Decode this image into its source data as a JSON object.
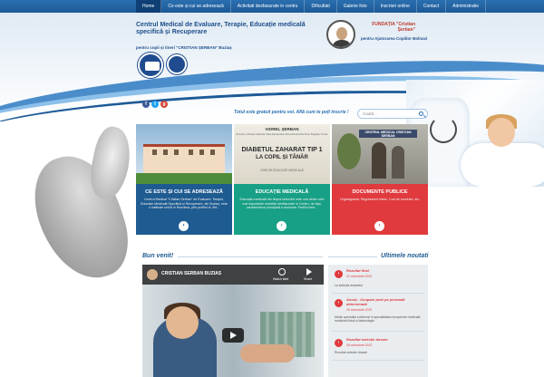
{
  "nav": {
    "items": [
      "Home",
      "Ce este și cui se adresează",
      "Activitati desfasurate in centru",
      "Dificultati",
      "Galerie foto",
      "Inscrieri online",
      "Contact",
      "Administratie"
    ],
    "active_index": 0
  },
  "header": {
    "org_title": "Centrul Medical de Evaluare, Terapie, Educație medicală specifică și Recuperare",
    "org_subtitle": "pentru copii și tineri \"CRISTIAN ȘERBAN\" Buziaș",
    "foundation_name": "FUNDAȚIA \"Cristian Șerban\"",
    "foundation_subtitle": "pentru Ajutorarea Copiilor Bolnavi"
  },
  "social": {
    "fb": "f",
    "tw": "t",
    "gp": "g"
  },
  "tagline": "Totul este gratuit pentru voi. Află cum te poți înscrie !",
  "search": {
    "placeholder": "Caută..."
  },
  "cards": [
    {
      "title": "CE ESTE ȘI CUI SE ADRESEAZĂ",
      "text": "Centrul Medical \"Cristian Șerban\" de Evaluare, Terapie, Educație Medicală Specifică și Recuperare, din Buziaș, este o instituție unică în România, prin profilul el, fiid..."
    },
    {
      "title": "EDUCAȚIE MEDICALĂ",
      "text": "Educația medicală din timpul internării este una dintre cele mai importante activități desfășurate în Centru, de fapt, caracteristica principală a acestuia. Profilul este...",
      "book": {
        "author": "VIOREL ȘERBAN",
        "authors": "Dumitru Chiriac   Adriana Vlad   Alexandra Sima   Florentina Tecu   Bogdan Timar",
        "title1": "DIABETUL ZAHARAT TIP 1",
        "title2": "LA COPIL ȘI TÂNĂR",
        "guide": "GHID DE EDUCAȚIE MEDICALĂ"
      }
    },
    {
      "title": "DOCUMENTE PUBLICE",
      "text": "Organigrama, Regulament intern, Cod de conduita, etc.",
      "sign": "CENTRUL MEDICAL CRISTIAN ȘERBAN"
    }
  ],
  "welcome": "Bun venit!",
  "latest_title": "Ultimele noutati",
  "video": {
    "title": "CRISTIAN SERBAN BUZIAS",
    "watch_later": "Watch later",
    "share": "Share"
  },
  "news": [
    {
      "title": "Rezultat final",
      "date": "22 octombrie 2020",
      "desc": "La selecția dosarelor"
    },
    {
      "title": "Anunț - Ocupare post pe perioadă determinată",
      "date": "20 octombrie 2020",
      "desc": "Medic specialist confirmat în specialitatea recuperare medicală, medicină fizică și balneologie"
    },
    {
      "title": "Rezultat selecție dosare",
      "date": "08 octombrie 2020",
      "desc": "Rezultat selecție dosare"
    }
  ]
}
